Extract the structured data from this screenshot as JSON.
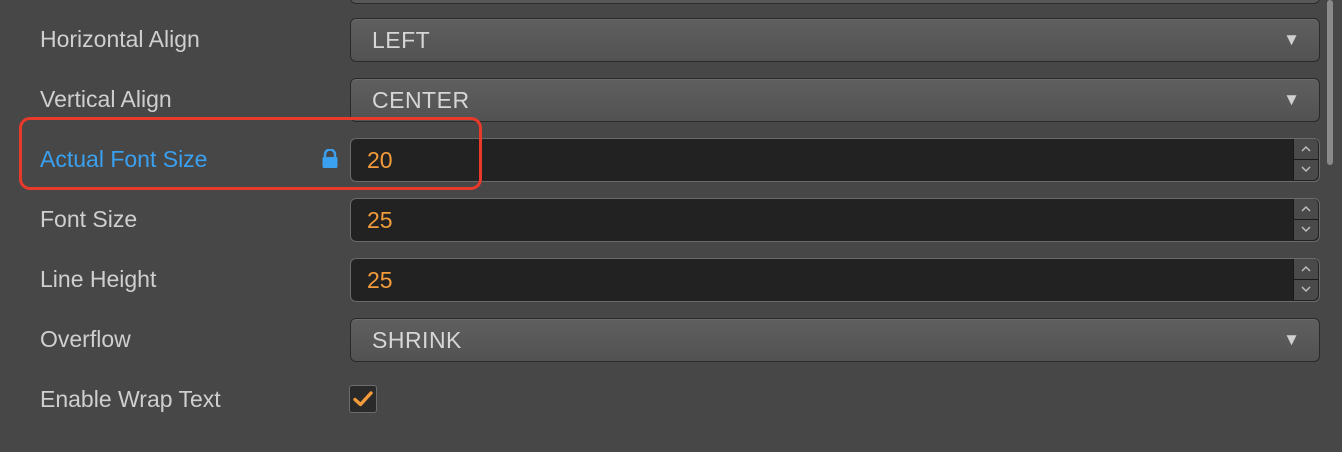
{
  "properties": {
    "horizontal_align": {
      "label": "Horizontal Align",
      "value": "LEFT"
    },
    "vertical_align": {
      "label": "Vertical Align",
      "value": "CENTER"
    },
    "actual_font_size": {
      "label": "Actual Font Size",
      "value": "20"
    },
    "font_size": {
      "label": "Font Size",
      "value": "25"
    },
    "line_height": {
      "label": "Line Height",
      "value": "25"
    },
    "overflow": {
      "label": "Overflow",
      "value": "SHRINK"
    },
    "enable_wrap_text": {
      "label": "Enable Wrap Text",
      "checked": true
    }
  },
  "icons": {
    "dropdown": "caret-down-icon",
    "lock": "lock-icon",
    "spinner_up": "chevron-up-icon",
    "spinner_down": "chevron-down-icon",
    "checkmark": "checkmark-icon"
  },
  "colors": {
    "panel_background": "#474747",
    "label_text": "#cfcfcf",
    "active_label": "#3aa0f0",
    "numeric_value": "#f29b3b",
    "highlight_box": "#e8392b",
    "checkmark": "#f29b3b"
  }
}
